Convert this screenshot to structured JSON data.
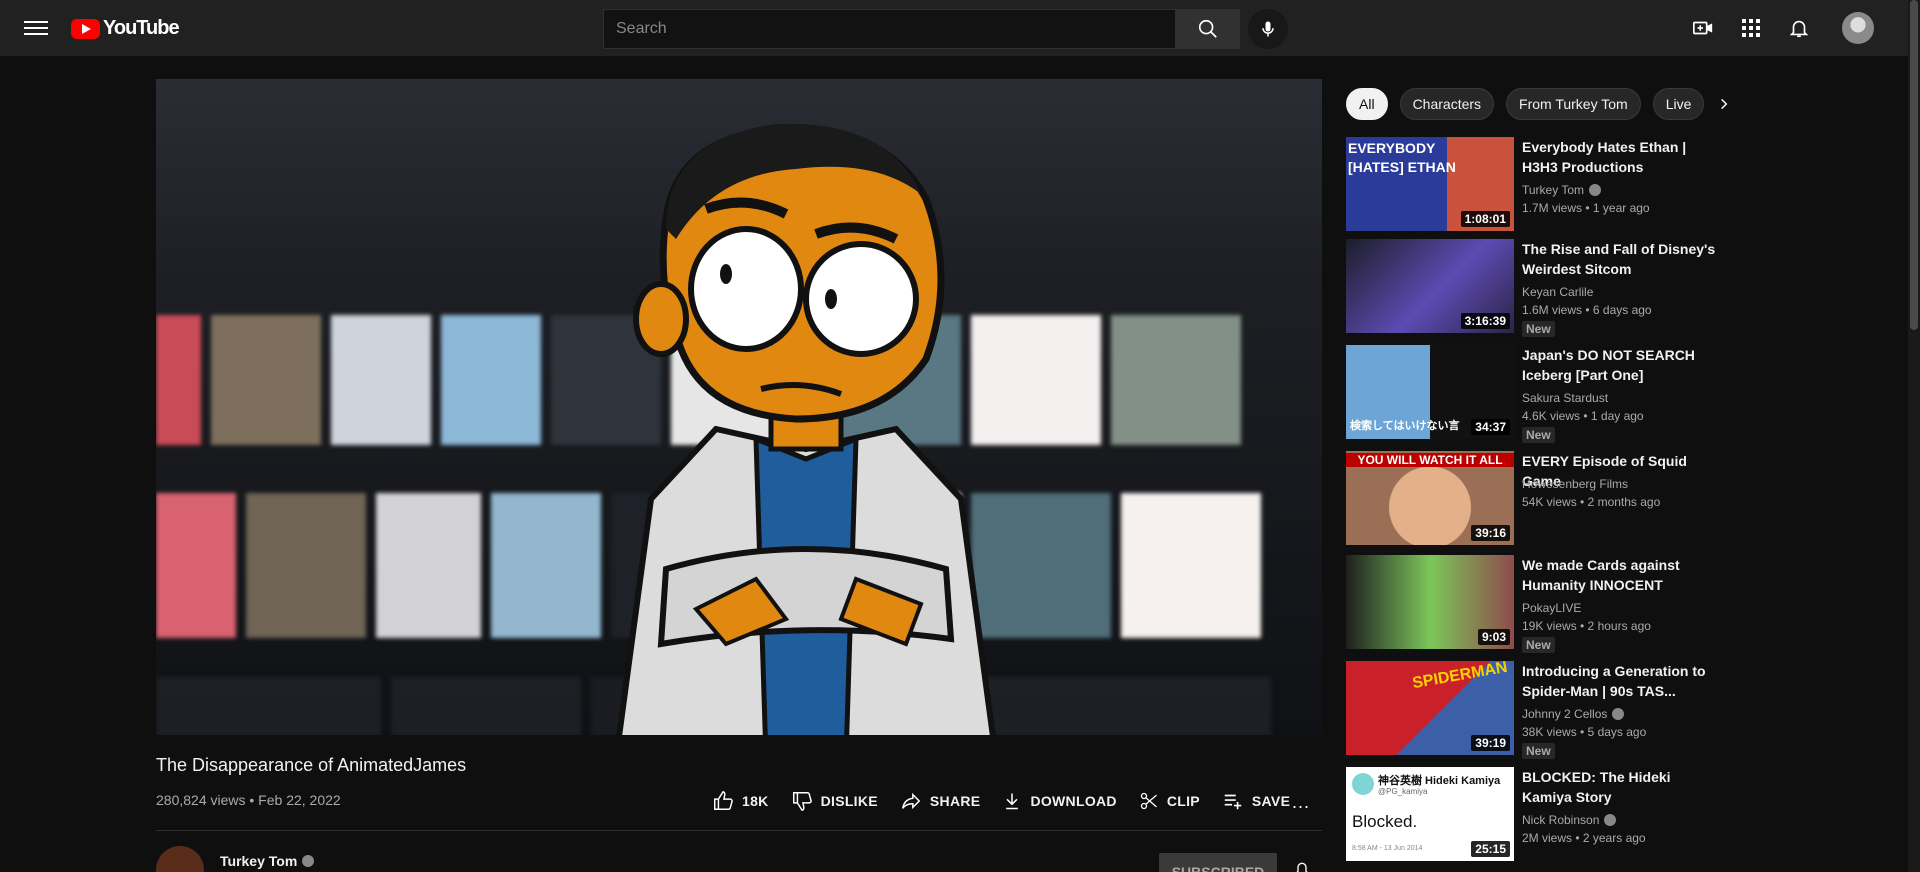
{
  "header": {
    "logo_text": "YouTube",
    "search_placeholder": "Search"
  },
  "video": {
    "title": "The Disappearance of AnimatedJames",
    "views": "280,824 views • Feb 22, 2022",
    "like_count": "18K",
    "dislike_label": "DISLIKE",
    "share_label": "SHARE",
    "download_label": "DOWNLOAD",
    "clip_label": "CLIP",
    "save_label": "SAVE",
    "more_label": "..."
  },
  "channel": {
    "name": "Turkey Tom",
    "subscribe_label": "SUBSCRIBED"
  },
  "chips": [
    "All",
    "Characters",
    "From Turkey Tom",
    "Live"
  ],
  "recommendations": [
    {
      "title": "Everybody Hates Ethan | H3H3 Productions",
      "channel": "Turkey Tom",
      "verified": true,
      "meta": "1.7M views • 1 year ago",
      "duration": "1:08:01",
      "badge": "",
      "thumb_text": "EVERYBODY [HATES] ETHAN"
    },
    {
      "title": "The Rise and Fall of Disney's Weirdest Sitcom",
      "channel": "Keyan Carlile",
      "verified": false,
      "meta": "1.6M views • 6 days ago",
      "duration": "3:16:39",
      "badge": "New",
      "thumb_text": ""
    },
    {
      "title": "Japan's DO NOT SEARCH Iceberg [Part One]",
      "channel": "Sakura Stardust",
      "verified": false,
      "meta": "4.6K views • 1 day ago",
      "duration": "34:37",
      "badge": "New",
      "thumb_text": "検索してはいけない言"
    },
    {
      "title": "EVERY Episode of Squid Game",
      "channel": "Howesenberg Films",
      "verified": false,
      "meta": "54K views • 2 months ago",
      "duration": "39:16",
      "badge": "",
      "thumb_text": "YOU WILL WATCH IT ALL"
    },
    {
      "title": "We made Cards against Humanity INNOCENT",
      "channel": "PokayLIVE",
      "verified": false,
      "meta": "19K views • 2 hours ago",
      "duration": "9:03",
      "badge": "New",
      "thumb_text": ""
    },
    {
      "title": "Introducing a Generation to Spider-Man | 90s TAS...",
      "channel": "Johnny 2 Cellos",
      "verified": true,
      "meta": "38K views • 5 days ago",
      "duration": "39:19",
      "badge": "New",
      "thumb_text": "SPIDERMAN"
    },
    {
      "title": "BLOCKED: The Hideki Kamiya Story",
      "channel": "Nick Robinson",
      "verified": true,
      "meta": "2M views • 2 years ago",
      "duration": "25:15",
      "badge": "",
      "thumb_text": "神谷英樹 Hideki Kamiya",
      "thumb_sub": "@PG_kamiya",
      "thumb_body": "Blocked.",
      "thumb_date": "8:58 AM - 13 Jun 2014"
    }
  ],
  "colors": {
    "background": "#0f0f0f",
    "header": "#212121",
    "brand_red": "#ff0000",
    "chip": "#272727"
  }
}
